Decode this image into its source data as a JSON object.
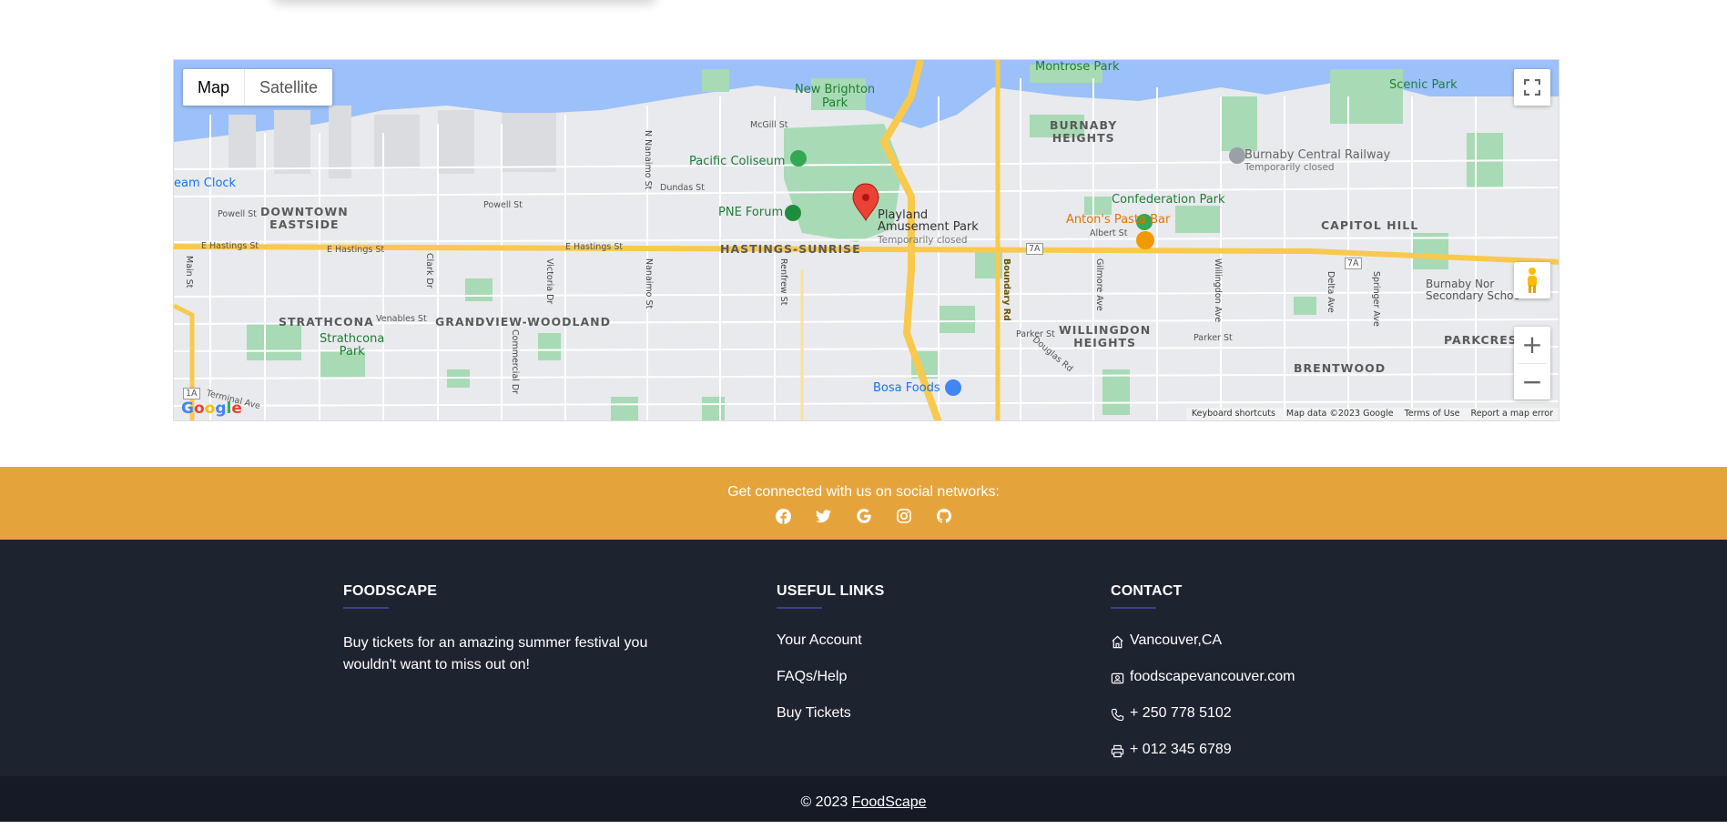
{
  "map": {
    "type_map": "Map",
    "type_satellite": "Satellite",
    "google": "Google",
    "attribution": [
      "Keyboard shortcuts",
      "Map data ©2023 Google",
      "Terms of Use",
      "Report a map error"
    ],
    "labels": {
      "montrose": "Montrose Park",
      "new_brighton": "New Brighton\nPark",
      "scenic": "Scenic Park",
      "mcgill": "McGill St",
      "burnaby_heights": "BURNABY\nHEIGHTS",
      "burnaby_railway": "Burnaby Central Railway",
      "temp_closed_1": "Temporarily closed",
      "steam_clock": "eam Clock",
      "pacific_coliseum": "Pacific Coliseum",
      "dundas": "Dundas St",
      "confederation": "Confederation Park",
      "downtown_eastside": "DOWNTOWN\nEASTSIDE",
      "powell_1": "Powell St",
      "powell_2": "Powell St",
      "pne_forum": "PNE Forum",
      "playland": "Playland\nAmusement Park",
      "temp_closed_2": "Temporarily closed",
      "antons": "Anton's Pasta Bar",
      "albert": "Albert St",
      "capitol_hill": "CAPITOL HILL",
      "e_hastings_1": "E Hastings St",
      "e_hastings_2": "E Hastings St",
      "e_hastings_3": "E Hastings St",
      "hastings_sunrise": "HASTINGS-SUNRISE",
      "hwy_7a_1": "7A",
      "hwy_7a_2": "7A",
      "hwy_1a": "1A",
      "burnaby_north": "Burnaby Nor\nSecondary Schoo",
      "strathcona": "STRATHCONA",
      "venables": "Venables St",
      "grandview": "GRANDVIEW-WOODLAND",
      "strathcona_park": "Strathcona\nPark",
      "willingdon_heights": "WILLINGDON\nHEIGHTS",
      "parker_1": "Parker St",
      "parker_2": "Parker St",
      "parkcrest": "PARKCREST",
      "brentwood": "BRENTWOOD",
      "bosa": "Bosa Foods",
      "terminal": "Terminal Ave",
      "douglas": "Douglas Rd",
      "main": "Main St",
      "clark": "Clark Dr",
      "victoria": "Victoria Dr",
      "nanaimo_n": "N Nanaimo St",
      "nanaimo": "Nanaimo St",
      "renfrew": "Renfrew St",
      "boundary": "Boundary Rd",
      "gilmore": "Gilmore Ave",
      "willingdon": "Willingdon Ave",
      "delta": "Delta Ave",
      "springer": "Springer Ave",
      "commercial": "Commercial Dr"
    }
  },
  "social": {
    "text": "Get connected with us on social networks:",
    "icons": [
      "facebook-icon",
      "twitter-icon",
      "google-icon",
      "instagram-icon",
      "github-icon"
    ]
  },
  "footer": {
    "brand_title": "FOODSCAPE",
    "brand_text": "Buy tickets for an amazing summer festival you wouldn't want to miss out on!",
    "links_title": "USEFUL LINKS",
    "links": [
      "Your Account",
      "FAQs/Help",
      "Buy Tickets"
    ],
    "contact_title": "CONTACT",
    "contact": {
      "address": "Vancouver,CA",
      "email": "foodscapevancouver.com",
      "phone": "+ 250 778 5102",
      "fax": "+ 012 345 6789"
    },
    "copyright_prefix": "© 2023",
    "copyright_link": "FoodScape"
  },
  "colors": {
    "social_bar": "#e5a43b",
    "footer_bg": "#1e2330",
    "copyright_bg": "#151a26",
    "water": "#9cc0f9",
    "park": "#a8dab5",
    "highway": "#f9c94d"
  }
}
